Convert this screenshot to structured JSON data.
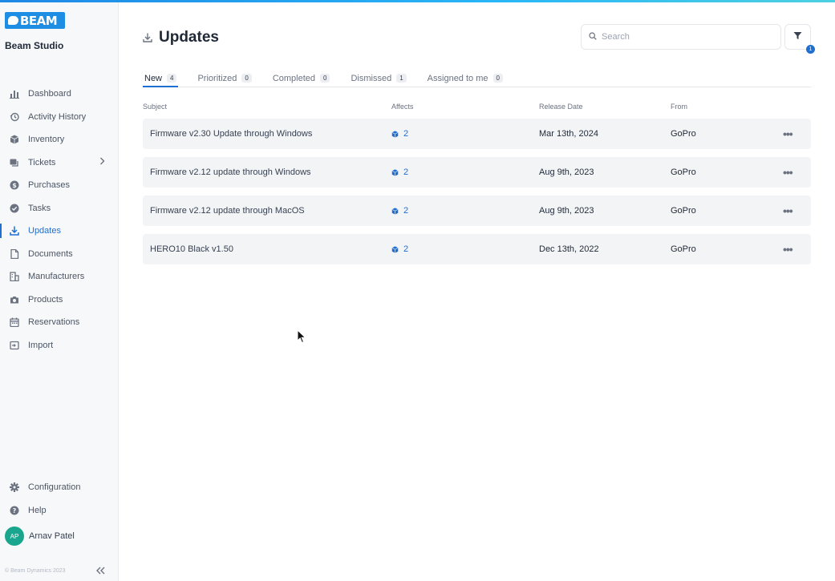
{
  "app": {
    "logo_text": "BEAM",
    "brand_name": "Beam Studio",
    "copyright": "© Beam Dynamics 2023",
    "accent_color": "#1f6fd1"
  },
  "sidebar": {
    "items": [
      {
        "label": "Dashboard",
        "icon": "bar-chart-icon"
      },
      {
        "label": "Activity History",
        "icon": "history-icon"
      },
      {
        "label": "Inventory",
        "icon": "cube-icon"
      },
      {
        "label": "Tickets",
        "icon": "ticket-icon"
      },
      {
        "label": "Purchases",
        "icon": "dollar-icon"
      },
      {
        "label": "Tasks",
        "icon": "check-circle-icon"
      },
      {
        "label": "Updates",
        "icon": "download-icon"
      },
      {
        "label": "Documents",
        "icon": "document-icon"
      },
      {
        "label": "Manufacturers",
        "icon": "building-icon"
      },
      {
        "label": "Products",
        "icon": "camera-icon"
      },
      {
        "label": "Reservations",
        "icon": "calendar-icon"
      },
      {
        "label": "Import",
        "icon": "import-icon"
      }
    ],
    "active": "Updates",
    "bottom_items": [
      {
        "label": "Configuration",
        "icon": "gear-icon"
      },
      {
        "label": "Help",
        "icon": "help-icon"
      }
    ],
    "user": {
      "initials": "AP",
      "name": "Arnav Patel"
    }
  },
  "page": {
    "title": "Updates",
    "search_placeholder": "Search",
    "filter_count": "1"
  },
  "tabs": [
    {
      "label": "New",
      "count": "4"
    },
    {
      "label": "Prioritized",
      "count": "0"
    },
    {
      "label": "Completed",
      "count": "0"
    },
    {
      "label": "Dismissed",
      "count": "1"
    },
    {
      "label": "Assigned to me",
      "count": "0"
    }
  ],
  "table": {
    "headers": {
      "subject": "Subject",
      "affects": "Affects",
      "release_date": "Release Date",
      "from": "From"
    },
    "rows": [
      {
        "subject": "Firmware v2.30 Update through Windows",
        "affects": "2",
        "release_date": "Mar 13th, 2024",
        "from": "GoPro"
      },
      {
        "subject": "Firmware v2.12 update through Windows",
        "affects": "2",
        "release_date": "Aug 9th, 2023",
        "from": "GoPro"
      },
      {
        "subject": "Firmware v2.12 update through MacOS",
        "affects": "2",
        "release_date": "Aug 9th, 2023",
        "from": "GoPro"
      },
      {
        "subject": "HERO10 Black v1.50",
        "affects": "2",
        "release_date": "Dec 13th, 2022",
        "from": "GoPro"
      }
    ],
    "more_glyph": "•••"
  }
}
